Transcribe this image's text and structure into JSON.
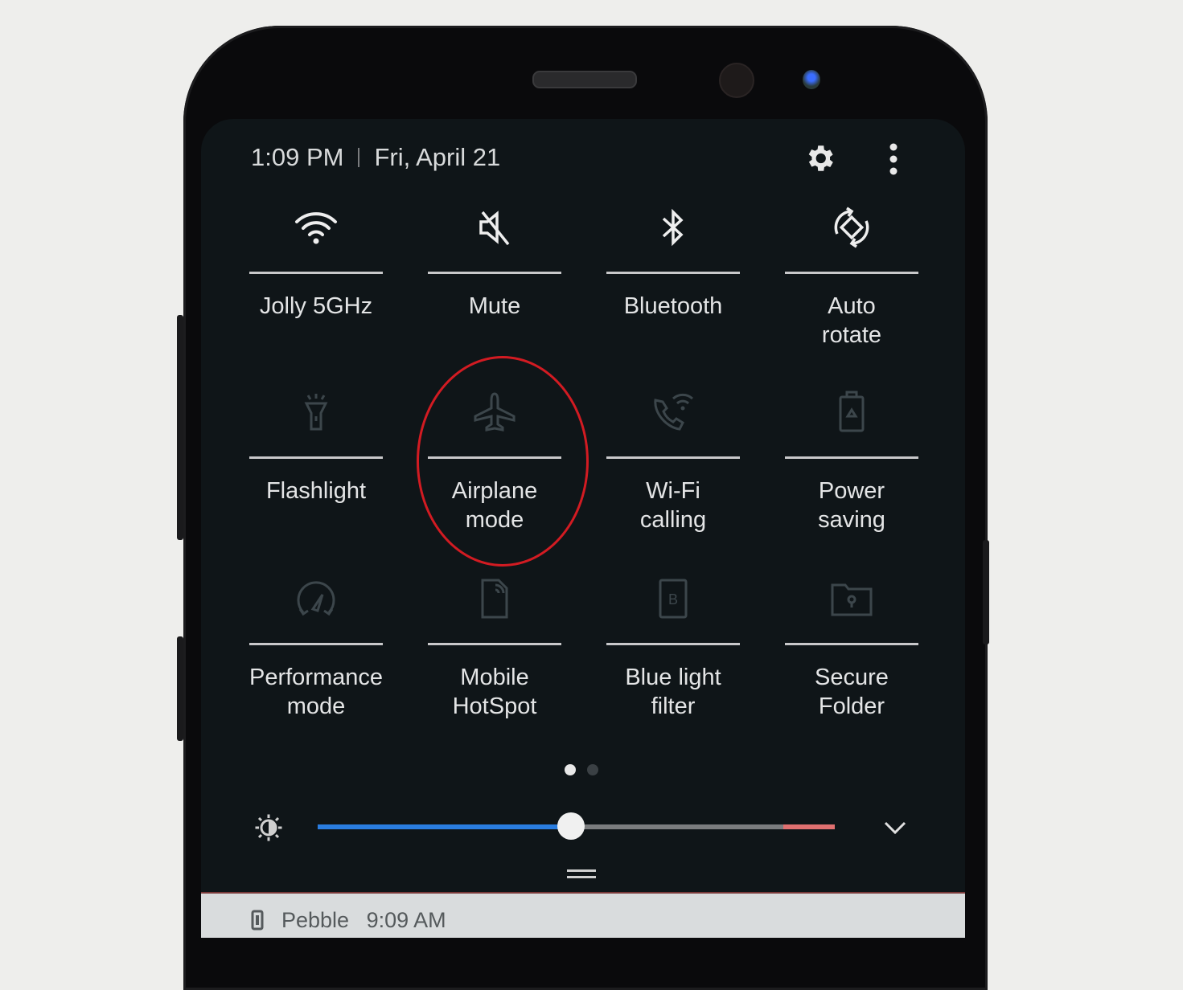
{
  "status": {
    "time": "1:09 PM",
    "date": "Fri, April 21"
  },
  "header_icons": {
    "settings": "gear-icon",
    "more": "more-vertical-icon"
  },
  "tiles": [
    {
      "label": "Jolly 5GHz",
      "icon": "wifi-icon",
      "active": true
    },
    {
      "label": "Mute",
      "icon": "mute-icon",
      "active": true
    },
    {
      "label": "Bluetooth",
      "icon": "bluetooth-icon",
      "active": true
    },
    {
      "label": "Auto\nrotate",
      "icon": "auto-rotate-icon",
      "active": true
    },
    {
      "label": "Flashlight",
      "icon": "flashlight-icon",
      "active": false
    },
    {
      "label": "Airplane\nmode",
      "icon": "airplane-icon",
      "active": false
    },
    {
      "label": "Wi-Fi\ncalling",
      "icon": "wifi-calling-icon",
      "active": false
    },
    {
      "label": "Power\nsaving",
      "icon": "power-saving-icon",
      "active": false
    },
    {
      "label": "Performance\nmode",
      "icon": "performance-icon",
      "active": false
    },
    {
      "label": "Mobile\nHotSpot",
      "icon": "hotspot-icon",
      "active": false
    },
    {
      "label": "Blue light\nfilter",
      "icon": "blue-light-icon",
      "active": false
    },
    {
      "label": "Secure\nFolder",
      "icon": "secure-folder-icon",
      "active": false
    }
  ],
  "pages": {
    "current": 1,
    "total": 2
  },
  "brightness": {
    "value_percent": 49,
    "icon": "brightness-icon",
    "fill_color": "#2a7de0",
    "track_color": "#7a7c7e",
    "high_color": "#e07070"
  },
  "expand_icon": "chevron-down-icon",
  "annotation": {
    "highlight": "Airplane mode",
    "color": "#d21b22"
  },
  "notification": {
    "app": "Pebble",
    "time": "9:09 AM",
    "icon": "phone-device-icon"
  }
}
